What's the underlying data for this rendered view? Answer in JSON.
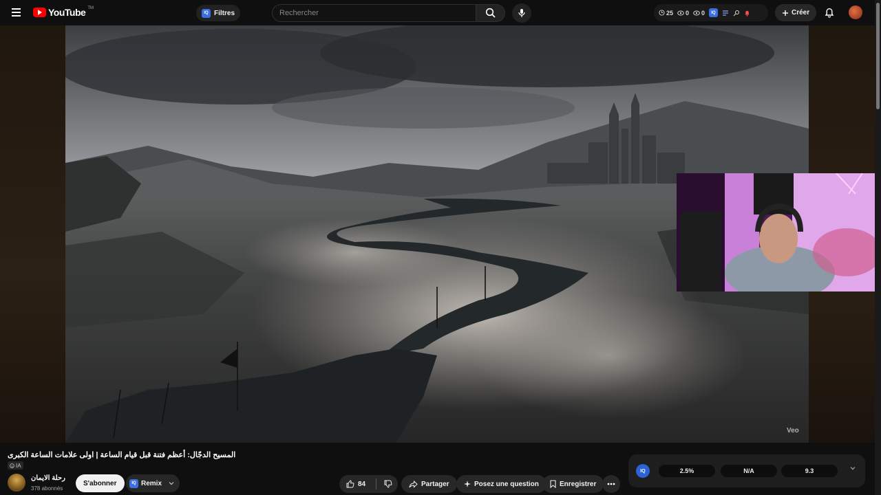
{
  "header": {
    "logo_text": "YouTube",
    "logo_sup": "TM",
    "filter_label": "Filtres",
    "iq_short": "IQ",
    "search_placeholder": "Rechercher",
    "stats": [
      {
        "icon": "clock-icon",
        "value": "25"
      },
      {
        "icon": "eye-icon",
        "value": "0"
      },
      {
        "icon": "eye-icon",
        "value": "0"
      }
    ],
    "create_label": "Créer"
  },
  "player": {
    "watermark": "Veo"
  },
  "video": {
    "title": "المسيح الدجّال: أعظم فتنة قبل قيام الساعة | اولى علامات الساعة الكبرى",
    "tag": "IA"
  },
  "channel": {
    "name": "رحلة الايمان",
    "subscribers": "378 abonnés",
    "subscribe_label": "S'abonner",
    "remix_label": "Remix"
  },
  "actions": {
    "likes": "84",
    "share_label": "Partager",
    "ask_label": "Posez une question",
    "save_label": "Enregistrer"
  },
  "iq_panel": {
    "logo": "IQ",
    "metrics": [
      "2.5%",
      "N/A",
      "9.3"
    ]
  },
  "colors": {
    "brand_red": "#ff0000",
    "iq_blue": "#2b62d6",
    "background": "#0f0f0f"
  }
}
